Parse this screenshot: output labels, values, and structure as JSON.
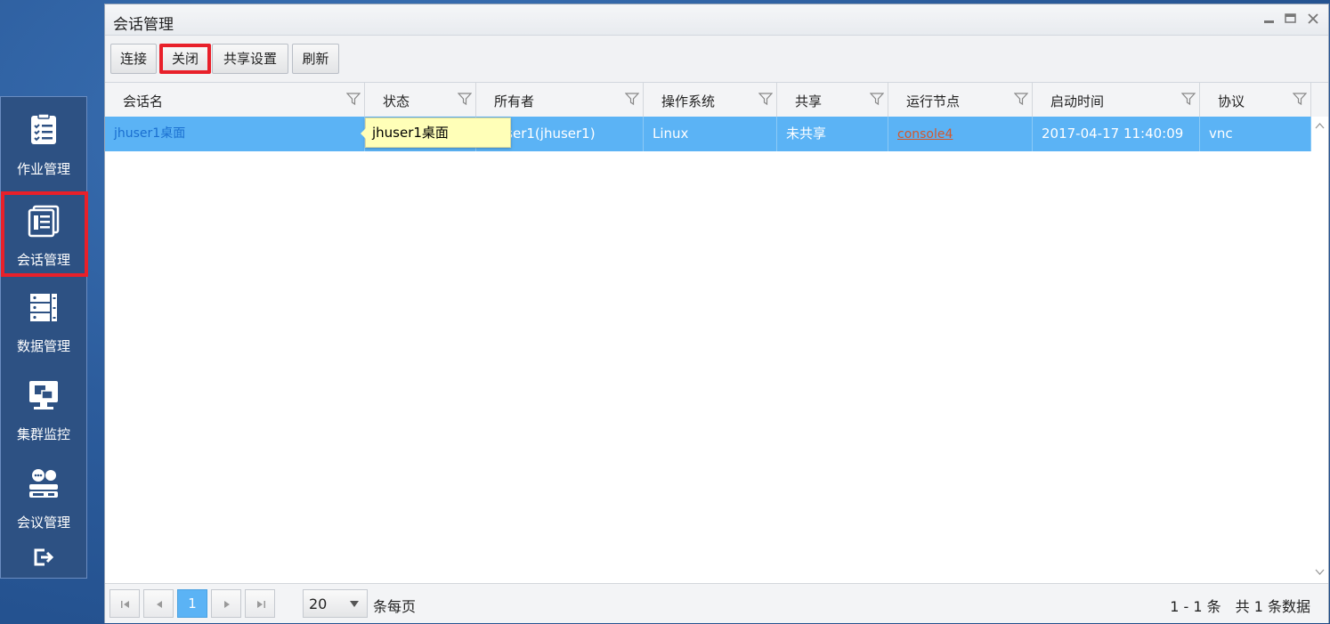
{
  "sidebar": {
    "items": [
      {
        "label": "作业管理",
        "icon": "job-list-icon"
      },
      {
        "label": "会话管理",
        "icon": "session-icon",
        "active": true
      },
      {
        "label": "数据管理",
        "icon": "data-storage-icon"
      },
      {
        "label": "集群监控",
        "icon": "monitor-icon"
      },
      {
        "label": "会议管理",
        "icon": "meeting-icon"
      }
    ],
    "logout_icon": "logout-icon"
  },
  "window": {
    "title": "会话管理",
    "controls": [
      "minimize-icon",
      "maximize-icon",
      "close-icon"
    ]
  },
  "toolbar": {
    "connect_label": "连接",
    "close_label": "关闭",
    "share_label": "共享设置",
    "refresh_label": "刷新"
  },
  "grid": {
    "columns": [
      "会话名",
      "状态",
      "所有者",
      "操作系统",
      "共享",
      "运行节点",
      "启动时间",
      "协议"
    ],
    "rows": [
      {
        "name": "jhuser1桌面",
        "status": "",
        "owner": "jhuser1(jhuser1)",
        "os": "Linux",
        "share": "未共享",
        "node": "console4",
        "start_time": "2017-04-17 11:40:09",
        "protocol": "vnc"
      }
    ],
    "tooltip": "jhuser1桌面"
  },
  "pager": {
    "current_page": "1",
    "page_size": "20",
    "page_size_label": "条每页",
    "info": "1 - 1 条　共 1 条数据"
  },
  "colors": {
    "selected_row": "#5bb3f5",
    "highlight": "#e8202a",
    "sidebar_bg": "#2d5183"
  }
}
